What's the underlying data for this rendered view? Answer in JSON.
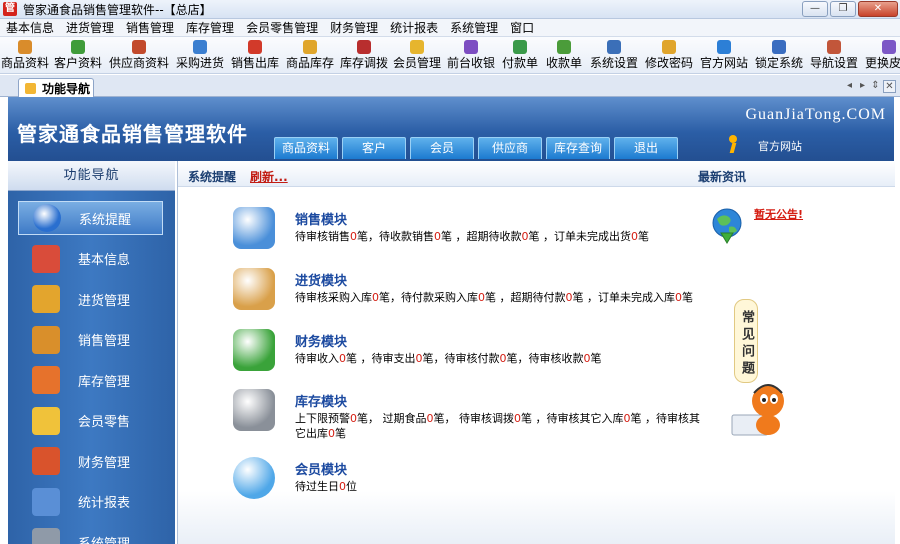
{
  "window": {
    "title": "管家通食品销售管理软件--【总店】",
    "app_icon_glyph": "管",
    "controls": {
      "minimize": "—",
      "maximize": "❐",
      "close": "✕"
    }
  },
  "menu": [
    "基本信息",
    "进货管理",
    "销售管理",
    "库存管理",
    "会员零售管理",
    "财务管理",
    "统计报表",
    "系统管理",
    "窗口"
  ],
  "toolbar": [
    {
      "label": "商品资料",
      "icon": "goods-icon",
      "color": "#d98c2b"
    },
    {
      "label": "客户资料",
      "icon": "customers-icon",
      "color": "#3f9c3a"
    },
    {
      "label": "供应商资料",
      "icon": "suppliers-icon",
      "color": "#c24a2c"
    },
    {
      "label": "采购进货",
      "icon": "truck-icon",
      "color": "#3b7fd0"
    },
    {
      "label": "销售出库",
      "icon": "cart-icon",
      "color": "#d23a2a"
    },
    {
      "label": "商品库存",
      "icon": "boxes-icon",
      "color": "#e0a62c"
    },
    {
      "label": "库存调拨",
      "icon": "transfer-icon",
      "color": "#b82e2e"
    },
    {
      "label": "会员管理",
      "icon": "member-icon",
      "color": "#e6b52e"
    },
    {
      "label": "前台收银",
      "icon": "cashier-icon",
      "color": "#7d4ec2"
    },
    {
      "label": "付款单",
      "icon": "payment-icon",
      "color": "#3a9a4a"
    },
    {
      "label": "收款单",
      "icon": "receipt-icon",
      "color": "#4b9c3a"
    },
    {
      "label": "系统设置",
      "icon": "settings-icon",
      "color": "#3b6fb8"
    },
    {
      "label": "修改密码",
      "icon": "key-icon",
      "color": "#e0a52c"
    },
    {
      "label": "官方网站",
      "icon": "ie-icon",
      "color": "#2c7fd6"
    },
    {
      "label": "锁定系统",
      "icon": "lock-screen-icon",
      "color": "#3a6dc0"
    },
    {
      "label": "导航设置",
      "icon": "nav-settings-icon",
      "color": "#c2563a"
    },
    {
      "label": "更换皮肤",
      "icon": "skin-icon",
      "color": "#7c58c6"
    }
  ],
  "doc_tab": {
    "label": "功能导航"
  },
  "banner": {
    "brand": "管家通食品销售管理软件",
    "site": "GuanJiaTong.COM",
    "nav_tabs": [
      "商品资料",
      "客户",
      "会员",
      "供应商",
      "库存查询",
      "退出"
    ],
    "site_link": "官方网站"
  },
  "leftnav": {
    "title": "功能导航",
    "items": [
      {
        "label": "系统提醒",
        "icon": "info-icon",
        "color": "#2a6fcf",
        "active": true
      },
      {
        "label": "基本信息",
        "icon": "cubes-icon",
        "color": "#d94c3a",
        "active": false
      },
      {
        "label": "进货管理",
        "icon": "boxes-in-icon",
        "color": "#e3a52d",
        "active": false
      },
      {
        "label": "销售管理",
        "icon": "boxes-out-icon",
        "color": "#d98f2b",
        "active": false
      },
      {
        "label": "库存管理",
        "icon": "warehouse-icon",
        "color": "#e6722c",
        "active": false
      },
      {
        "label": "会员零售",
        "icon": "members-icon",
        "color": "#f0c23a",
        "active": false
      },
      {
        "label": "财务管理",
        "icon": "finance-icon",
        "color": "#d9532c",
        "active": false
      },
      {
        "label": "统计报表",
        "icon": "chart-icon",
        "color": "#5a8fd6",
        "active": false
      },
      {
        "label": "系统管理",
        "icon": "gears-icon",
        "color": "#8f9aa8",
        "active": false
      }
    ]
  },
  "content": {
    "section_title": "系统提醒",
    "refresh": "刷新...",
    "news_title": "最新资讯",
    "notice": "暂无公告!",
    "faq": "常见问题",
    "modules": [
      {
        "title": "销售模块",
        "icon": "book-icon",
        "color": "#4a8fd9",
        "desc": [
          {
            "t": "待审核销售",
            "n": "0",
            "s": "笔，"
          },
          {
            "t": "待收款销售",
            "n": "0",
            "s": "笔 ，"
          },
          {
            "t": "超期待收款",
            "n": "0",
            "s": "笔 ，"
          },
          {
            "t": "订单未完成出货",
            "n": "0",
            "s": "笔"
          }
        ]
      },
      {
        "title": "进货模块",
        "icon": "box-in-icon",
        "color": "#d9a04a",
        "desc": [
          {
            "t": "待审核采购入库",
            "n": "0",
            "s": "笔，"
          },
          {
            "t": "待付款采购入库",
            "n": "0",
            "s": "笔 ，"
          },
          {
            "t": "超期待付款",
            "n": "0",
            "s": "笔 ，"
          },
          {
            "t": "订单未完成入库",
            "n": "0",
            "s": "笔"
          }
        ]
      },
      {
        "title": "财务模块",
        "icon": "money-icon",
        "color": "#3aa33a",
        "desc": [
          {
            "t": "待审收入",
            "n": "0",
            "s": "笔 ，"
          },
          {
            "t": "待审支出",
            "n": "0",
            "s": "笔，"
          },
          {
            "t": "待审核付款",
            "n": "0",
            "s": "笔，"
          },
          {
            "t": "待审核收款",
            "n": "0",
            "s": "笔"
          }
        ]
      },
      {
        "title": "库存模块",
        "icon": "database-icon",
        "color": "#8a9099",
        "desc": [
          {
            "t": "上下限预警",
            "n": "0",
            "s": "笔，  "
          },
          {
            "t": "过期食品",
            "n": "0",
            "s": "笔，  "
          },
          {
            "t": "待审核调拨",
            "n": "0",
            "s": "笔 ，"
          },
          {
            "t": "待审核其它入库",
            "n": "0",
            "s": "笔 ，"
          },
          {
            "t": "待审核其它出库",
            "n": "0",
            "s": "笔"
          }
        ]
      },
      {
        "title": "会员模块",
        "icon": "users-icon",
        "color": "#4fa7e8",
        "desc": [
          {
            "t": "待过生日",
            "n": "0",
            "s": "位"
          }
        ]
      }
    ]
  }
}
